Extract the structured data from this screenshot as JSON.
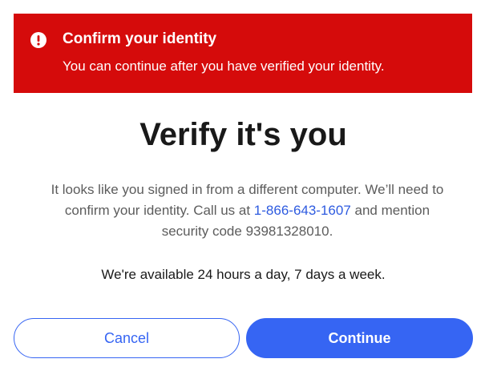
{
  "alert": {
    "icon": "exclamation-circle-icon",
    "title": "Confirm your identity",
    "message": "You can continue after you have verified your identity.",
    "background_color": "#d50b0b"
  },
  "main": {
    "heading": "Verify it's you",
    "body_line1": "It looks like you signed in from a different computer. We’ll need to",
    "body_line2_prefix": "confirm your identity. Call us at ",
    "phone_number": "1-866-643-1607",
    "body_line2_suffix": " and mention",
    "body_line3": "security code 93981328010.",
    "availability": "We're available 24 hours a day, 7 days a week."
  },
  "actions": {
    "cancel_label": "Cancel",
    "continue_label": "Continue",
    "primary_color": "#3665f3"
  }
}
